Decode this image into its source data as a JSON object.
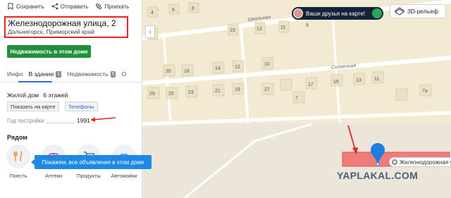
{
  "toolbar": {
    "save_label": "Сохранить",
    "send_label": "Отправить",
    "route_label": "Проехать"
  },
  "place": {
    "title": "Железнодорожная улица, 2",
    "subtitle": "Дальнегорск, Приморский край"
  },
  "realty_button": "Недвижимость в этом доме",
  "tabs": [
    {
      "label": "Инфо",
      "count": ""
    },
    {
      "label": "В здании",
      "count": "1"
    },
    {
      "label": "Недвижимость",
      "count": "5"
    },
    {
      "label": "О",
      "count": ""
    }
  ],
  "house": {
    "type": "Жилой дом",
    "floors": "6 этажей",
    "show_on_map": "Показать на карте",
    "phone": "Телефоны",
    "year_label": "Год постройки",
    "year_value": "1991"
  },
  "nearby": {
    "title": "Рядом",
    "categories": [
      {
        "label": "Поесть",
        "icon": "fork-knife-icon"
      },
      {
        "label": "Аптеки",
        "icon": "pharmacy-icon"
      },
      {
        "label": "Продукты",
        "icon": "cart-icon"
      },
      {
        "label": "Автомойки",
        "icon": "car-wash-icon"
      }
    ],
    "tooltip": "Покажем, все объявления в этом доме"
  },
  "map": {
    "friends_label": "Ваши друзья на карте!",
    "relief_label": "3D-рельеф",
    "street_school": "Школьная",
    "street_sunny": "Солнечная",
    "house_numbers": [
      "4",
      "6",
      "8",
      "15",
      "13",
      "11",
      "9",
      "20",
      "18",
      "14",
      "12",
      "10",
      "25",
      "23",
      "21",
      "19",
      "17",
      "15",
      "13",
      "11",
      "29",
      "27",
      "7",
      "7a"
    ],
    "selected_address": "Железнодорожная у",
    "watermark": "YAPLAKAL.COM"
  },
  "colors": {
    "accent_green": "#1f8f3a",
    "highlight_red": "#e32525",
    "tooltip_blue": "#1e88e5",
    "map_bg": "#f4ecd6",
    "building": "#ebe3c9",
    "selected_building": "#ef7b7b"
  }
}
